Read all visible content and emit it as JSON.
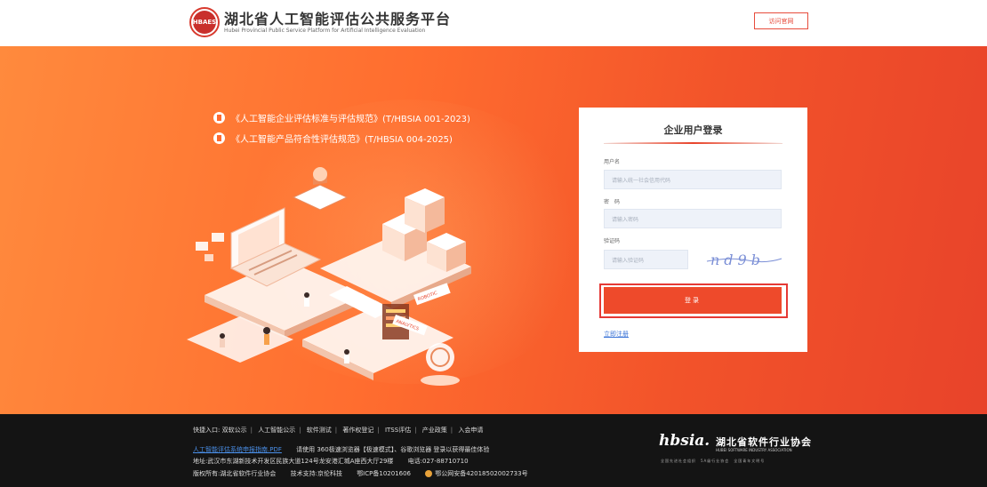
{
  "header": {
    "logo_badge_text": "HBAES",
    "title": "湖北省人工智能评估公共服务平台",
    "subtitle": "Hubei Provincial Public Service Platform for Artificial Intelligence Evaluation",
    "visit_button": "访问官网"
  },
  "hero": {
    "standards": [
      "《人工智能企业评估标准与评估规范》(T/HBSIA 001-2023)",
      "《人工智能产品符合性评估规范》(T/HBSIA 004-2025)"
    ],
    "illustration_signs": [
      "ROBOTIC",
      "ANALYTICS"
    ]
  },
  "login": {
    "title": "企业用户登录",
    "username_label": "用户名",
    "username_placeholder": "请输入统一社会信用代码",
    "password_label": "密　码",
    "password_placeholder": "请输入密码",
    "captcha_label": "验证码",
    "captcha_placeholder": "请输入验证码",
    "captcha_text": "nd9b",
    "submit": "登录",
    "register": "立即注册"
  },
  "footer": {
    "quick_label": "快捷入口:",
    "quick_links": [
      "双软公示",
      "人工智能公示",
      "软件测试",
      "著作权登记",
      "ITSS评估",
      "产业政策",
      "入会申请"
    ],
    "guide_link": "人工智能评估系统申报指南.PDF",
    "browser_tip": "请使用 360极速浏览器【极速模式】、谷歌浏览器 登录以获得最佳体验",
    "address": "地址:武汉市东湖新技术开发区民族大道124号龙安港汇城A座西大厅29楼",
    "phone": "电话:027-88710710",
    "copyright": "版权所有:湖北省软件行业协会",
    "tech_support": "技术支持:京伦科技",
    "icp": "鄂ICP备10201606",
    "police": "鄂公网安备42018502002733号",
    "assoc_abbr": "hbsia.",
    "assoc_name": "湖北省软件行业协会",
    "assoc_en": "HUBEI SOFTWARE INDUSTRY ASSOCIATION",
    "assoc_tagline": "全国先进社会组织　5A级行业协会　全国青年文明号"
  },
  "colors": {
    "accent": "#ee4a2b",
    "hero_start": "#ff8a3d",
    "hero_end": "#e8432a",
    "footer_bg": "#141414",
    "link": "#3b74d7"
  }
}
